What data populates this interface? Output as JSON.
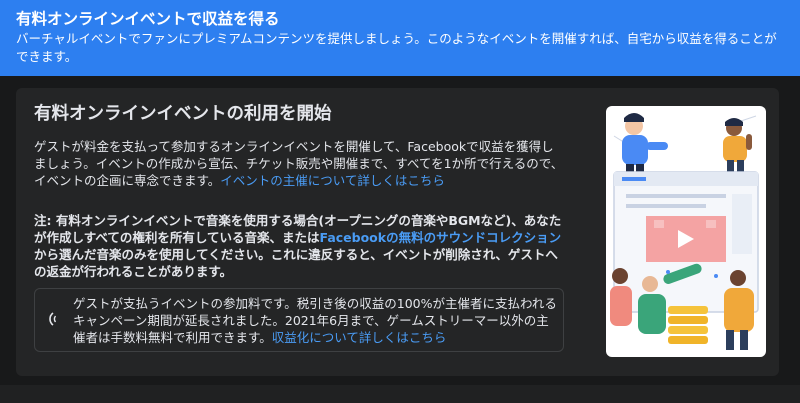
{
  "banner": {
    "title": "有料オンラインイベントで収益を得る",
    "text": "バーチャルイベントでファンにプレミアムコンテンツを提供しましょう。このようなイベントを開催すれば、自宅から収益を得ることができます。"
  },
  "card": {
    "title": "有料オンラインイベントの利用を開始",
    "paragraph1": {
      "text": "ゲストが料金を支払って参加するオンラインイベントを開催して、Facebookで収益を獲得しましょう。イベントの作成から宣伝、チケット販売や開催まで、すべてを1か所で行えるので、イベントの企画に専念できます。",
      "link": "イベントの主催について詳しくはこちら"
    },
    "paragraph2": {
      "text_before": "注: 有料オンラインイベントで音楽を使用する場合(オープニングの音楽やBGMなど)、あなたが作成しすべての権利を所有している音楽、または",
      "link": "Facebookの無料のサウンドコレクション",
      "text_after": "から選んだ音楽のみを使用してください。これに違反すると、イベントが削除され、ゲストへの返金が行われることがあります。"
    },
    "notice": {
      "icon": "megaphone-icon",
      "text": "ゲストが支払うイベントの参加料です。税引き後の収益の100%が主催者に支払われるキャンペーン期間が延長されました。2021年6月まで、ゲームストリーマー以外の主催者は手数料無料で利用できます。",
      "link": "収益化について詳しくはこちら"
    }
  },
  "colors": {
    "banner": "#2d7ff0",
    "background": "#18191a",
    "card": "#242526",
    "link": "#4a9cf5",
    "text": "#e4e6eb"
  }
}
